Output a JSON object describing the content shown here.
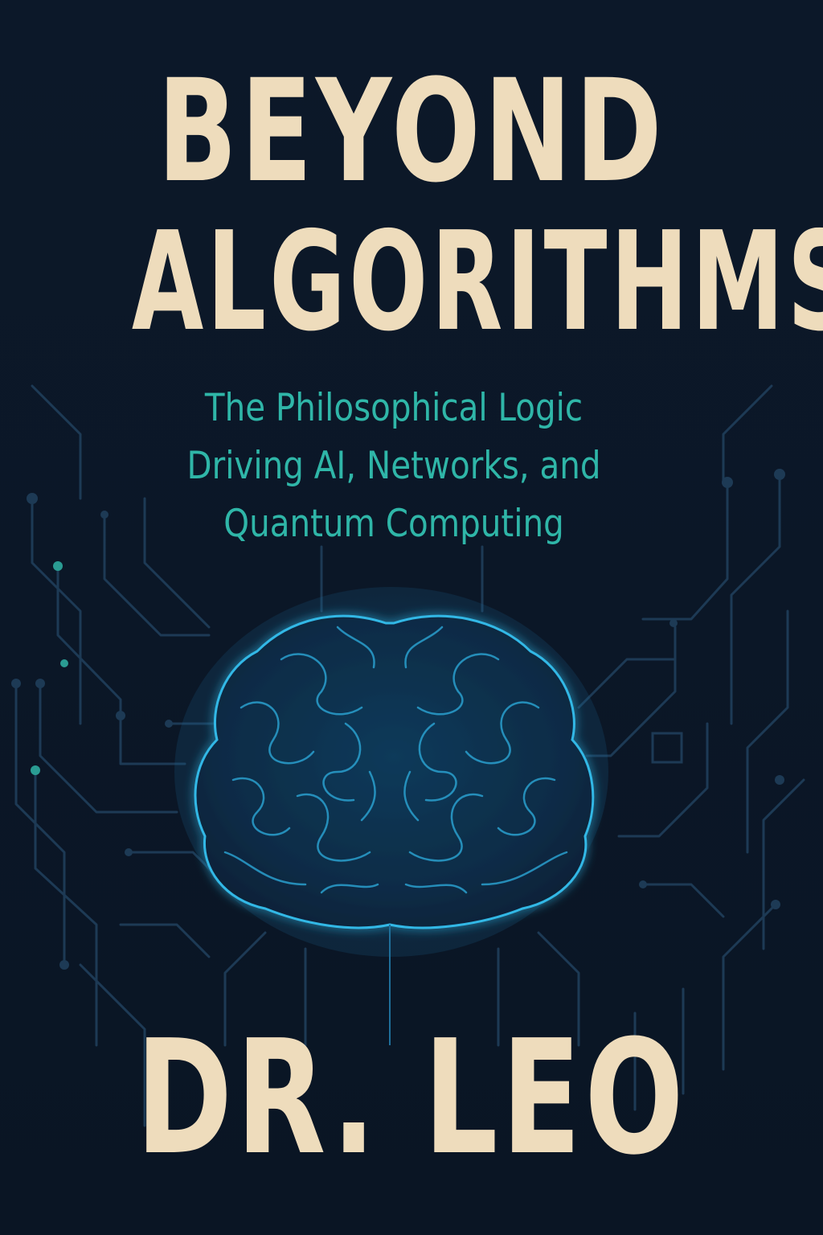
{
  "cover": {
    "title_line1": "BEYOND",
    "title_line2": "ALGORITHMS",
    "subtitle_lines": [
      "The Philosophical Logic",
      "Driving AI, Networks, and",
      "Quantum Computing"
    ],
    "author": "DR. LEO"
  },
  "colors": {
    "background": "#0b1628",
    "title": "#eedcbc",
    "subtitle": "#2fb6a8",
    "brain_glow": "#33b8e6",
    "circuit": "#1d3a55"
  },
  "icons": [
    "brain-icon",
    "circuit-pattern"
  ]
}
